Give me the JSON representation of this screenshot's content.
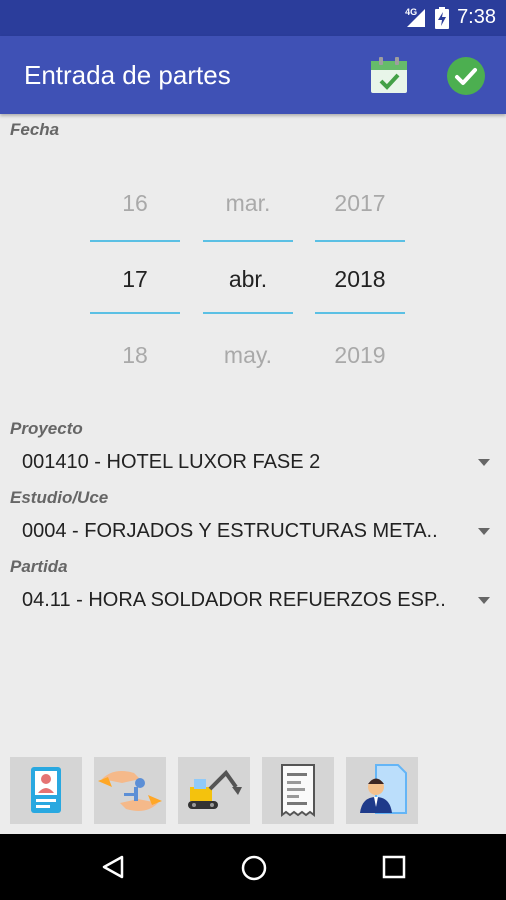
{
  "status_bar": {
    "network": "4G",
    "time": "7:38"
  },
  "app_bar": {
    "title": "Entrada de partes",
    "calendar_icon": "calendar-check-icon",
    "confirm_icon": "check-circle-icon"
  },
  "date_section": {
    "label": "Fecha",
    "day": {
      "prev": "16",
      "current": "17",
      "next": "18"
    },
    "month": {
      "prev": "mar.",
      "current": "abr.",
      "next": "may."
    },
    "year": {
      "prev": "2017",
      "current": "2018",
      "next": "2019"
    }
  },
  "fields": {
    "proyecto": {
      "label": "Proyecto",
      "value": "001410 - HOTEL LUXOR FASE 2"
    },
    "estudio": {
      "label": "Estudio/Uce",
      "value": "0004 - FORJADOS Y ESTRUCTURAS META.."
    },
    "partida": {
      "label": "Partida",
      "value": "04.11 - HORA SOLDADOR REFUERZOS ESP.."
    }
  },
  "toolbar": {
    "icons": [
      "id-card-icon",
      "handshake-keys-icon",
      "excavator-icon",
      "receipt-icon",
      "employee-document-icon"
    ]
  },
  "nav": {
    "icons": [
      "back-icon",
      "home-icon",
      "recents-icon"
    ]
  },
  "colors": {
    "primary": "#3f51b5",
    "status": "#2b3d9b",
    "accent": "#5bc0e4",
    "check": "#4caf50"
  }
}
